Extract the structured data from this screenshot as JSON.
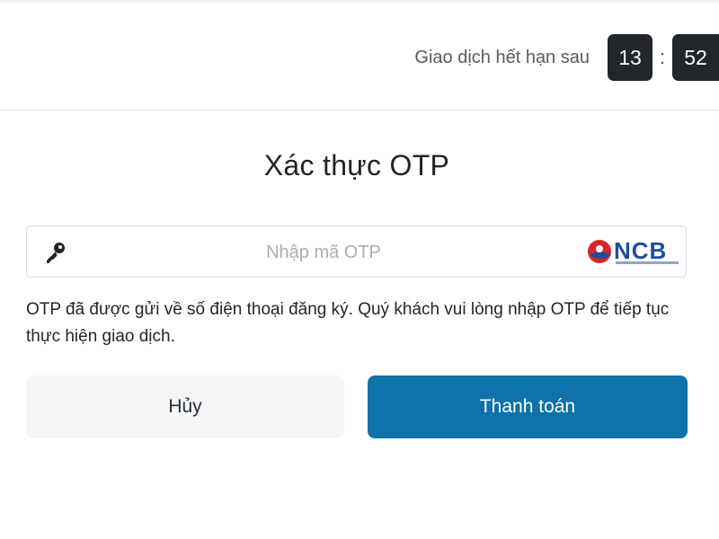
{
  "header": {
    "expiry_label": "Giao dịch hết hạn sau",
    "timer_minutes": "13",
    "timer_separator": ":",
    "timer_seconds": "52"
  },
  "main": {
    "title": "Xác thực OTP",
    "otp_field": {
      "placeholder": "Nhập mã OTP",
      "value": "",
      "icon": "key-icon",
      "bank_logo": "NCB"
    },
    "notice": "OTP đã được gửi về số điện thoại đăng ký. Quý khách vui lòng nhập OTP để tiếp tục thực hiện giao dịch.",
    "buttons": {
      "cancel_label": "Hủy",
      "pay_label": "Thanh toán"
    }
  },
  "colors": {
    "primary": "#0f72a8",
    "timer_bg": "#23272b",
    "cancel_bg": "#f4f5f7",
    "logo_blue": "#1f4e9c",
    "logo_red": "#d6262d"
  }
}
